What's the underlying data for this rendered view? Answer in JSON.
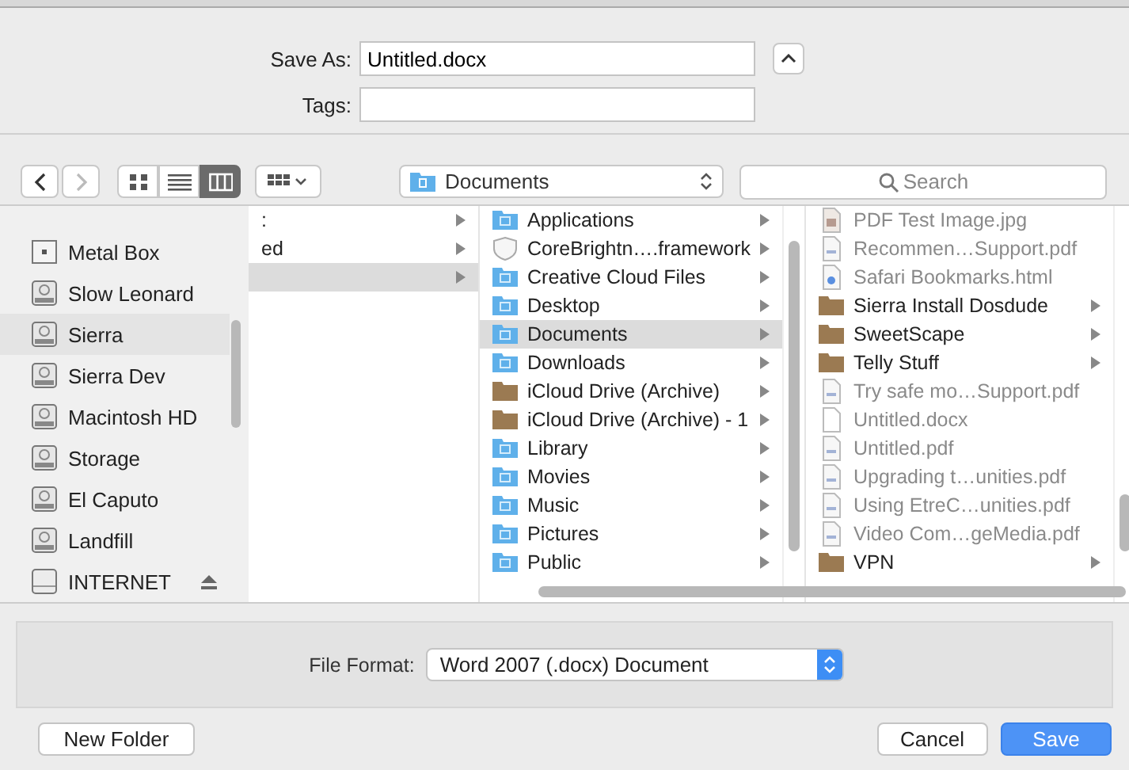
{
  "save_as": {
    "label": "Save As:",
    "value": "Untitled.docx"
  },
  "tags": {
    "label": "Tags:"
  },
  "navigation": [
    {
      "kind": "back",
      "disabled": false
    },
    {
      "kind": "forward",
      "disabled": true
    }
  ],
  "view_modes": [
    {
      "kind": "icons",
      "selected": false
    },
    {
      "kind": "list",
      "selected": false
    },
    {
      "kind": "columns",
      "selected": true
    }
  ],
  "location": "Documents",
  "search": {
    "placeholder": "Search"
  },
  "sidebar": {
    "items": [
      {
        "name": "Metal Box",
        "kind": "box",
        "selected": false,
        "ejectable": false
      },
      {
        "name": "Slow Leonard",
        "kind": "disk",
        "selected": false,
        "ejectable": false
      },
      {
        "name": "Sierra",
        "kind": "disk",
        "selected": true,
        "ejectable": false
      },
      {
        "name": "Sierra Dev",
        "kind": "disk",
        "selected": false,
        "ejectable": false
      },
      {
        "name": "Macintosh HD",
        "kind": "disk",
        "selected": false,
        "ejectable": false
      },
      {
        "name": "Storage",
        "kind": "disk",
        "selected": false,
        "ejectable": false
      },
      {
        "name": "El Caputo",
        "kind": "disk",
        "selected": false,
        "ejectable": false
      },
      {
        "name": "Landfill",
        "kind": "disk",
        "selected": false,
        "ejectable": false
      },
      {
        "name": "INTERNET",
        "kind": "external",
        "selected": false,
        "ejectable": true
      }
    ]
  },
  "columns": [
    {
      "items": [
        {
          "name": ":",
          "kind": "none",
          "selected": false,
          "disabled": false,
          "expandable": true
        },
        {
          "name": "ed",
          "kind": "none",
          "selected": false,
          "disabled": false,
          "expandable": true
        },
        {
          "kind": "none",
          "selected": true,
          "disabled": false,
          "expandable": true
        }
      ]
    },
    {
      "items": [
        {
          "name": "Applications",
          "kind": "system-folder",
          "selected": false,
          "disabled": false,
          "expandable": true
        },
        {
          "name": "CoreBrightn….framework",
          "kind": "bundle",
          "selected": false,
          "disabled": false,
          "expandable": true
        },
        {
          "name": "Creative Cloud Files",
          "kind": "system-folder",
          "selected": false,
          "disabled": false,
          "expandable": true
        },
        {
          "name": "Desktop",
          "kind": "system-folder",
          "selected": false,
          "disabled": false,
          "expandable": true
        },
        {
          "name": "Documents",
          "kind": "system-folder",
          "selected": true,
          "disabled": false,
          "expandable": true
        },
        {
          "name": "Downloads",
          "kind": "system-folder",
          "selected": false,
          "disabled": false,
          "expandable": true
        },
        {
          "name": "iCloud Drive (Archive)",
          "kind": "folder",
          "selected": false,
          "disabled": false,
          "expandable": true
        },
        {
          "name": "iCloud Drive (Archive) - 1",
          "kind": "folder",
          "selected": false,
          "disabled": false,
          "expandable": true
        },
        {
          "name": "Library",
          "kind": "system-folder",
          "selected": false,
          "disabled": false,
          "expandable": true
        },
        {
          "name": "Movies",
          "kind": "system-folder",
          "selected": false,
          "disabled": false,
          "expandable": true
        },
        {
          "name": "Music",
          "kind": "system-folder",
          "selected": false,
          "disabled": false,
          "expandable": true
        },
        {
          "name": "Pictures",
          "kind": "system-folder",
          "selected": false,
          "disabled": false,
          "expandable": true
        },
        {
          "name": "Public",
          "kind": "system-folder",
          "selected": false,
          "disabled": false,
          "expandable": true
        }
      ]
    },
    {
      "items": [
        {
          "name": "PDF Test Image.jpg",
          "kind": "image",
          "selected": false,
          "disabled": true,
          "expandable": false
        },
        {
          "name": "Recommen…Support.pdf",
          "kind": "pdf",
          "selected": false,
          "disabled": true,
          "expandable": false
        },
        {
          "name": "Safari Bookmarks.html",
          "kind": "html",
          "selected": false,
          "disabled": true,
          "expandable": false
        },
        {
          "name": "Sierra Install Dosdude",
          "kind": "folder",
          "selected": false,
          "disabled": false,
          "expandable": true
        },
        {
          "name": "SweetScape",
          "kind": "folder",
          "selected": false,
          "disabled": false,
          "expandable": true
        },
        {
          "name": "Telly Stuff",
          "kind": "folder",
          "selected": false,
          "disabled": false,
          "expandable": true
        },
        {
          "name": "Try safe mo…Support.pdf",
          "kind": "pdf",
          "selected": false,
          "disabled": true,
          "expandable": false
        },
        {
          "name": "Untitled.docx",
          "kind": "document",
          "selected": false,
          "disabled": true,
          "expandable": false
        },
        {
          "name": "Untitled.pdf",
          "kind": "pdf",
          "selected": false,
          "disabled": true,
          "expandable": false
        },
        {
          "name": "Upgrading t…unities.pdf",
          "kind": "pdf",
          "selected": false,
          "disabled": true,
          "expandable": false
        },
        {
          "name": "Using EtreC…unities.pdf",
          "kind": "pdf",
          "selected": false,
          "disabled": true,
          "expandable": false
        },
        {
          "name": "Video Com…geMedia.pdf",
          "kind": "pdf",
          "selected": false,
          "disabled": true,
          "expandable": false
        },
        {
          "name": "VPN",
          "kind": "folder",
          "selected": false,
          "disabled": false,
          "expandable": true
        }
      ]
    }
  ],
  "file_format": {
    "label": "File Format:",
    "value": "Word 2007 (.docx) Document"
  },
  "buttons": [
    {
      "label": "New Folder",
      "kind": "secondary"
    },
    {
      "label": "Cancel",
      "kind": "secondary"
    },
    {
      "label": "Save",
      "kind": "default"
    }
  ]
}
